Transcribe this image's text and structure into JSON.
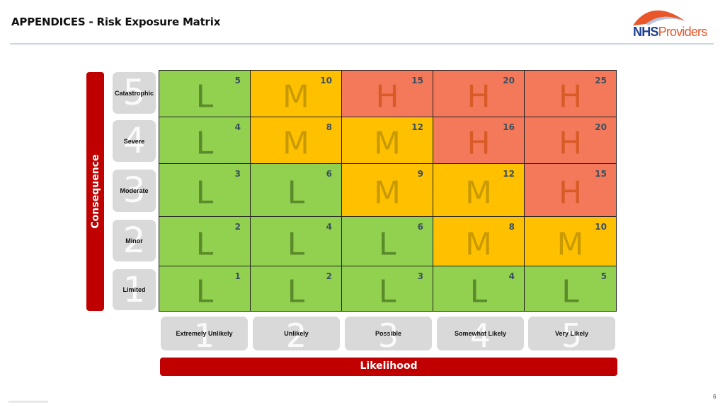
{
  "header": {
    "title": "APPENDICES - Risk Exposure Matrix",
    "logo": {
      "primary": "NHS",
      "secondary": "Providers",
      "colors": {
        "primary": "#1c3f94",
        "secondary": "#e8562a"
      }
    }
  },
  "page_number": "6",
  "axes": {
    "consequence": {
      "label": "Consequence",
      "levels": [
        {
          "value": "5",
          "label": "Catastrophic"
        },
        {
          "value": "4",
          "label": "Severe"
        },
        {
          "value": "3",
          "label": "Moderate"
        },
        {
          "value": "2",
          "label": "Minor"
        },
        {
          "value": "1",
          "label": "Limited"
        }
      ]
    },
    "likelihood": {
      "label": "Likelihood",
      "levels": [
        {
          "value": "1",
          "label": "Extremely Unlikely"
        },
        {
          "value": "2",
          "label": "Unlikely"
        },
        {
          "value": "3",
          "label": "Possible"
        },
        {
          "value": "4",
          "label": "Somewhat Likely"
        },
        {
          "value": "5",
          "label": "Very Likely"
        }
      ]
    }
  },
  "rating_colors": {
    "L": "#92d050",
    "M": "#ffc000",
    "H": "#f4795b"
  },
  "matrix": {
    "rows": [
      {
        "consequence": "5",
        "cells": [
          {
            "score": "5",
            "level": "L"
          },
          {
            "score": "10",
            "level": "M"
          },
          {
            "score": "15",
            "level": "H"
          },
          {
            "score": "20",
            "level": "H"
          },
          {
            "score": "25",
            "level": "H"
          }
        ]
      },
      {
        "consequence": "4",
        "cells": [
          {
            "score": "4",
            "level": "L"
          },
          {
            "score": "8",
            "level": "M"
          },
          {
            "score": "12",
            "level": "M"
          },
          {
            "score": "16",
            "level": "H"
          },
          {
            "score": "20",
            "level": "H"
          }
        ]
      },
      {
        "consequence": "3",
        "cells": [
          {
            "score": "3",
            "level": "L"
          },
          {
            "score": "6",
            "level": "L"
          },
          {
            "score": "9",
            "level": "M"
          },
          {
            "score": "12",
            "level": "M"
          },
          {
            "score": "15",
            "level": "H"
          }
        ]
      },
      {
        "consequence": "2",
        "cells": [
          {
            "score": "2",
            "level": "L"
          },
          {
            "score": "4",
            "level": "L"
          },
          {
            "score": "6",
            "level": "L"
          },
          {
            "score": "8",
            "level": "M"
          },
          {
            "score": "10",
            "level": "M"
          }
        ]
      },
      {
        "consequence": "1",
        "cells": [
          {
            "score": "1",
            "level": "L"
          },
          {
            "score": "2",
            "level": "L"
          },
          {
            "score": "3",
            "level": "L"
          },
          {
            "score": "4",
            "level": "L"
          },
          {
            "score": "5",
            "level": "L"
          }
        ]
      }
    ]
  }
}
